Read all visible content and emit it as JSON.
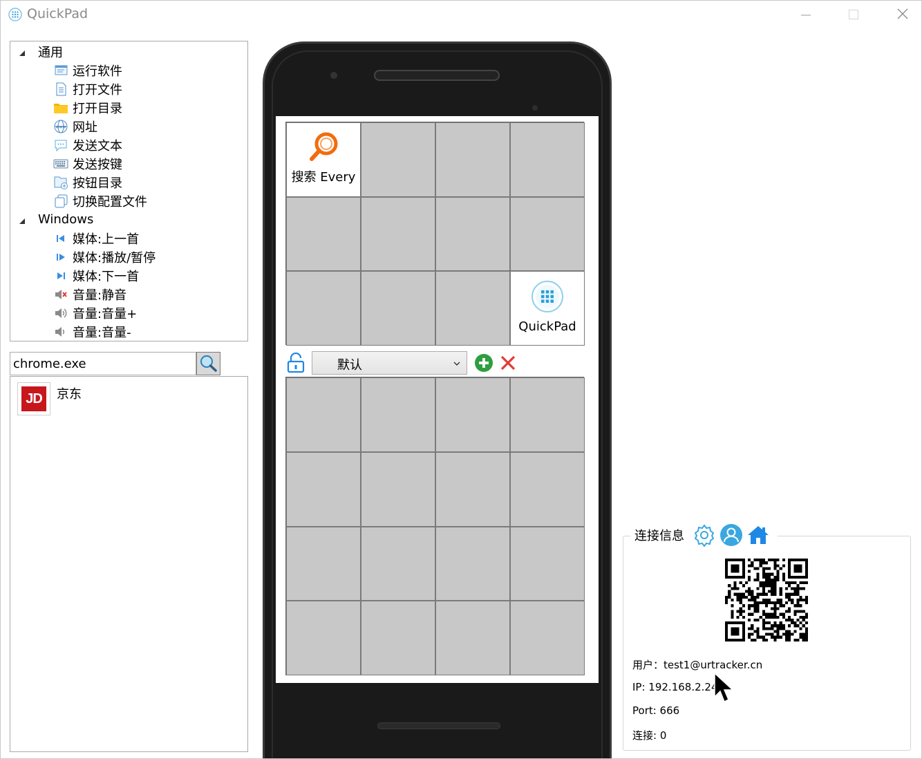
{
  "window": {
    "title": "QuickPad"
  },
  "tree": {
    "groups": [
      {
        "label": "通用",
        "items": [
          {
            "label": "运行软件",
            "icon": "window-app-icon"
          },
          {
            "label": "打开文件",
            "icon": "document-icon"
          },
          {
            "label": "打开目录",
            "icon": "folder-icon"
          },
          {
            "label": "网址",
            "icon": "globe-icon"
          },
          {
            "label": "发送文本",
            "icon": "chat-bubble-icon"
          },
          {
            "label": "发送按键",
            "icon": "keyboard-icon"
          },
          {
            "label": "按钮目录",
            "icon": "folder-add-icon"
          },
          {
            "label": "切换配置文件",
            "icon": "copy-icon"
          }
        ]
      },
      {
        "label": "Windows",
        "items": [
          {
            "label": "媒体:上一首",
            "icon": "previous-track-icon"
          },
          {
            "label": "媒体:播放/暂停",
            "icon": "play-pause-icon"
          },
          {
            "label": "媒体:下一首",
            "icon": "next-track-icon"
          },
          {
            "label": "音量:静音",
            "icon": "mute-icon"
          },
          {
            "label": "音量:音量+",
            "icon": "volume-up-icon"
          },
          {
            "label": "音量:音量-",
            "icon": "volume-down-icon"
          }
        ]
      }
    ]
  },
  "search": {
    "value": "chrome.exe"
  },
  "results": [
    {
      "label": "京东",
      "logo_text": "JD",
      "logo_color": "#c8161d"
    }
  ],
  "phone": {
    "top_grid": [
      {
        "label": "搜索 Every",
        "icon": "search-magnifier-icon"
      },
      null,
      null,
      null,
      null,
      null,
      null,
      null,
      null,
      null,
      null,
      {
        "label": "QuickPad",
        "icon": "quickpad-logo-icon"
      }
    ],
    "profile": {
      "selected": "默认"
    }
  },
  "connection": {
    "title": "连接信息",
    "user_line": "用户：test1@urtracker.cn",
    "ip_line": "IP: 192.168.2.248",
    "port_line": "Port: 666",
    "conn_line": "连接: 0"
  },
  "colors": {
    "accent_blue": "#1e88e5",
    "add_green": "#2e9e3e",
    "delete_red": "#e53935"
  }
}
